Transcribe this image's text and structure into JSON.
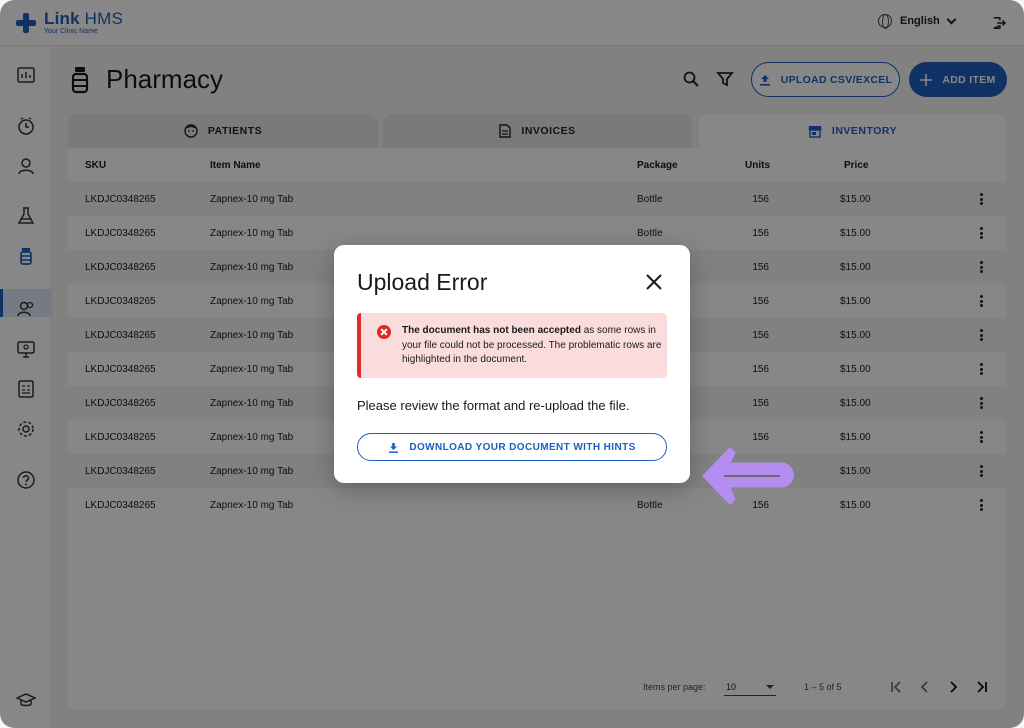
{
  "app": {
    "brand_bold": "Link",
    "brand_light": " HMS",
    "tagline": "Your Clinic Name",
    "language": "English"
  },
  "page": {
    "title": "Pharmacy",
    "upload_label": "UPLOAD CSV/EXCEL",
    "add_label": "ADD ITEM"
  },
  "tabs": [
    {
      "label": "PATIENTS",
      "icon": "face-icon",
      "active": false
    },
    {
      "label": "INVOICES",
      "icon": "document-icon",
      "active": false
    },
    {
      "label": "INVENTORY",
      "icon": "store-icon",
      "active": true
    }
  ],
  "table": {
    "headers": {
      "sku": "SKU",
      "name": "Item Name",
      "package": "Package",
      "units": "Units",
      "price": "Price"
    },
    "rows": [
      {
        "sku": "LKDJC0348265",
        "name": "Zapnex-10 mg Tab",
        "package": "Bottle",
        "units": "156",
        "price": "$15.00"
      },
      {
        "sku": "LKDJC0348265",
        "name": "Zapnex-10 mg Tab",
        "package": "Bottle",
        "units": "156",
        "price": "$15.00"
      },
      {
        "sku": "LKDJC0348265",
        "name": "Zapnex-10 mg Tab",
        "package": "",
        "units": "156",
        "price": "$15.00"
      },
      {
        "sku": "LKDJC0348265",
        "name": "Zapnex-10 mg Tab",
        "package": "",
        "units": "156",
        "price": "$15.00"
      },
      {
        "sku": "LKDJC0348265",
        "name": "Zapnex-10 mg Tab",
        "package": "",
        "units": "156",
        "price": "$15.00"
      },
      {
        "sku": "LKDJC0348265",
        "name": "Zapnex-10 mg Tab",
        "package": "",
        "units": "156",
        "price": "$15.00"
      },
      {
        "sku": "LKDJC0348265",
        "name": "Zapnex-10 mg Tab",
        "package": "",
        "units": "156",
        "price": "$15.00"
      },
      {
        "sku": "LKDJC0348265",
        "name": "Zapnex-10 mg Tab",
        "package": "",
        "units": "156",
        "price": "$15.00"
      },
      {
        "sku": "LKDJC0348265",
        "name": "Zapnex-10 mg Tab",
        "package": "",
        "units": "",
        "price": "$15.00"
      },
      {
        "sku": "LKDJC0348265",
        "name": "Zapnex-10 mg Tab",
        "package": "Bottle",
        "units": "156",
        "price": "$15.00"
      }
    ]
  },
  "pagination": {
    "items_per_page_label": "Items per page:",
    "items_per_page": "10",
    "range": "1 – 5 of 5"
  },
  "dialog": {
    "title": "Upload Error",
    "alert_bold": "The document has not been accepted",
    "alert_rest": " as some rows in your file could not be processed. The problematic rows are highlighted in the document.",
    "message": "Please review the format and re-upload the file.",
    "download_label": "DOWNLOAD YOUR DOCUMENT WITH HINTS"
  },
  "colors": {
    "primary": "#1f5fbf",
    "error": "#e02b2b",
    "error_bg": "#fbdcdc",
    "annotation": "#b58cf0"
  }
}
